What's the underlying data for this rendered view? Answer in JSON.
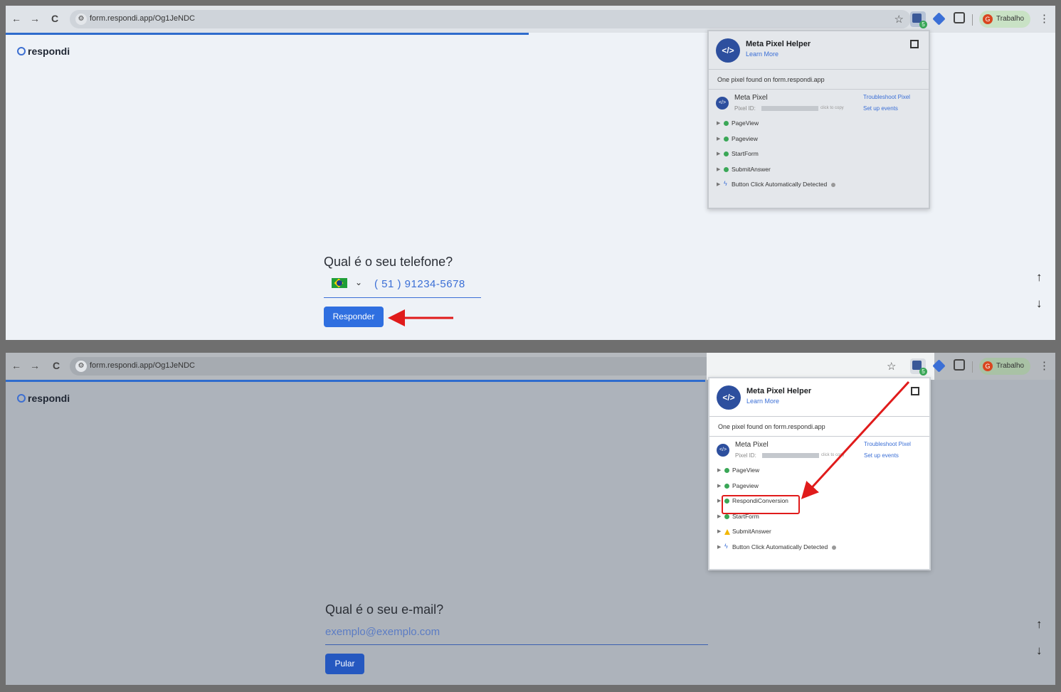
{
  "browser": {
    "url": "form.respondi.app/Og1JeNDC",
    "profile_name": "Trabalho",
    "profile_initial": "G",
    "nav_back": "←",
    "nav_forward": "→",
    "nav_reload": "C",
    "star": "☆",
    "kebab": "⋮",
    "site_info": "⚙",
    "ext_badge": "5"
  },
  "app": {
    "logo_text": "respondi"
  },
  "panel1": {
    "question": "Qual é o seu telefone?",
    "phone_value": "( 51 ) 91234-5678",
    "submit_label": "Responder",
    "progress_pct": 50
  },
  "panel2": {
    "question": "Qual é o seu e-mail?",
    "email_placeholder": "exemplo@exemplo.com",
    "skip_label": "Pular",
    "progress_pct": 67
  },
  "pixel_helper": {
    "title": "Meta Pixel Helper",
    "learn_more": "Learn More",
    "found_text": "One pixel found on form.respondi.app",
    "pixel_name": "Meta Pixel",
    "pixel_id_label": "Pixel ID:",
    "click_to_copy": "click to copy",
    "troubleshoot": "Troubleshoot Pixel",
    "setup_events": "Set up events",
    "logo_glyph": "</>"
  },
  "events_before": [
    {
      "label": "PageView",
      "status": "ok"
    },
    {
      "label": "Pageview",
      "status": "ok"
    },
    {
      "label": "StartForm",
      "status": "ok"
    },
    {
      "label": "SubmitAnswer",
      "status": "ok"
    },
    {
      "label": "Button Click Automatically Detected",
      "status": "auto"
    }
  ],
  "events_after": [
    {
      "label": "PageView",
      "status": "ok"
    },
    {
      "label": "Pageview",
      "status": "ok"
    },
    {
      "label": "RespondiConversion",
      "status": "ok"
    },
    {
      "label": "StartForm",
      "status": "ok"
    },
    {
      "label": "SubmitAnswer",
      "status": "warning"
    },
    {
      "label": "Button Click Automatically Detected",
      "status": "auto"
    }
  ],
  "colors": {
    "accent": "#2f6fe0",
    "annotation_red": "#e01b1b",
    "success": "#3aa757",
    "warning": "#f2b705"
  }
}
